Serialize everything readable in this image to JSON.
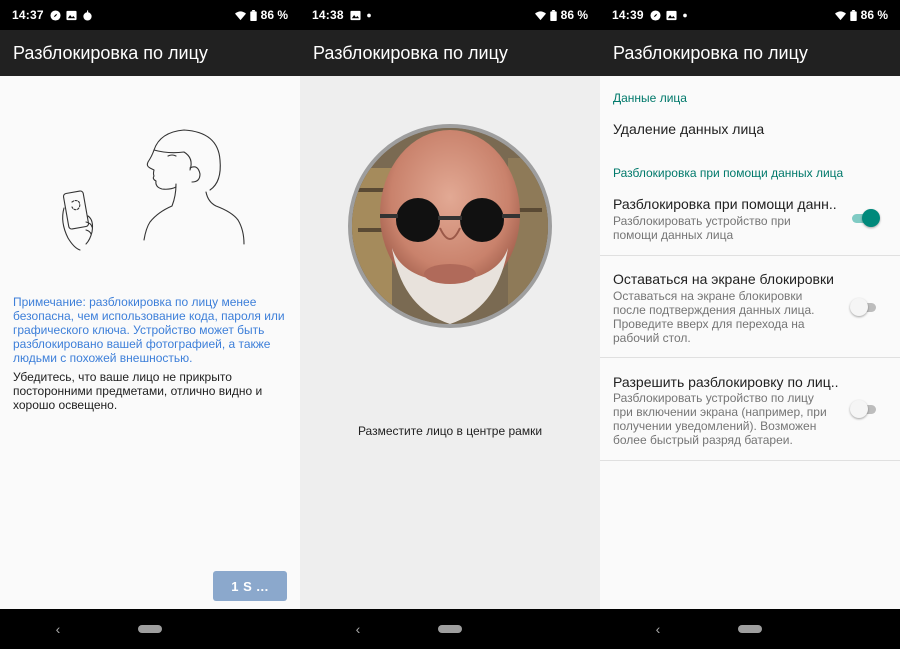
{
  "screens": [
    {
      "status": {
        "time": "14:37",
        "battery": "86 %"
      },
      "title": "Разблокировка по лицу",
      "note_blue": "Примечание: разблокировка по лицу менее безопасна, чем использование кода, пароля или графического ключа. Устройство может быть разблокировано вашей фотографией, а также людьми с похожей внешностью.",
      "note_dark": "Убедитесь, что ваше лицо не прикрыто посторонними предметами, отлично видно и хорошо освещено.",
      "button": "1 S ..."
    },
    {
      "status": {
        "time": "14:38",
        "battery": "86 %"
      },
      "title": "Разблокировка по лицу",
      "caption": "Разместите лицо в центре рамки"
    },
    {
      "status": {
        "time": "14:39",
        "battery": "86 %"
      },
      "title": "Разблокировка по лицу",
      "section1": "Данные лица",
      "delete_item": "Удаление данных лица",
      "section2": "Разблокировка при помощи данных лица",
      "prefs": [
        {
          "title": "Разблокировка при помощи данн..",
          "summary": "Разблокировать устройство при помощи данных лица",
          "enabled": true
        },
        {
          "title": "Оставаться на экране блокировки",
          "summary": "Оставаться на экране блокировки после подтверждения данных лица. Проведите вверх для перехода на рабочий стол.",
          "enabled": false
        },
        {
          "title": "Разрешить разблокировку по лиц..",
          "summary": "Разблокировать устройство по лицу при включении экрана (например, при получении уведомлений). Возможен более быстрый разряд батареи.",
          "enabled": false
        }
      ]
    }
  ],
  "colors": {
    "accent": "#00796b",
    "appbar": "#212121",
    "note": "#3d7fd9",
    "button": "#8ba8cc"
  }
}
